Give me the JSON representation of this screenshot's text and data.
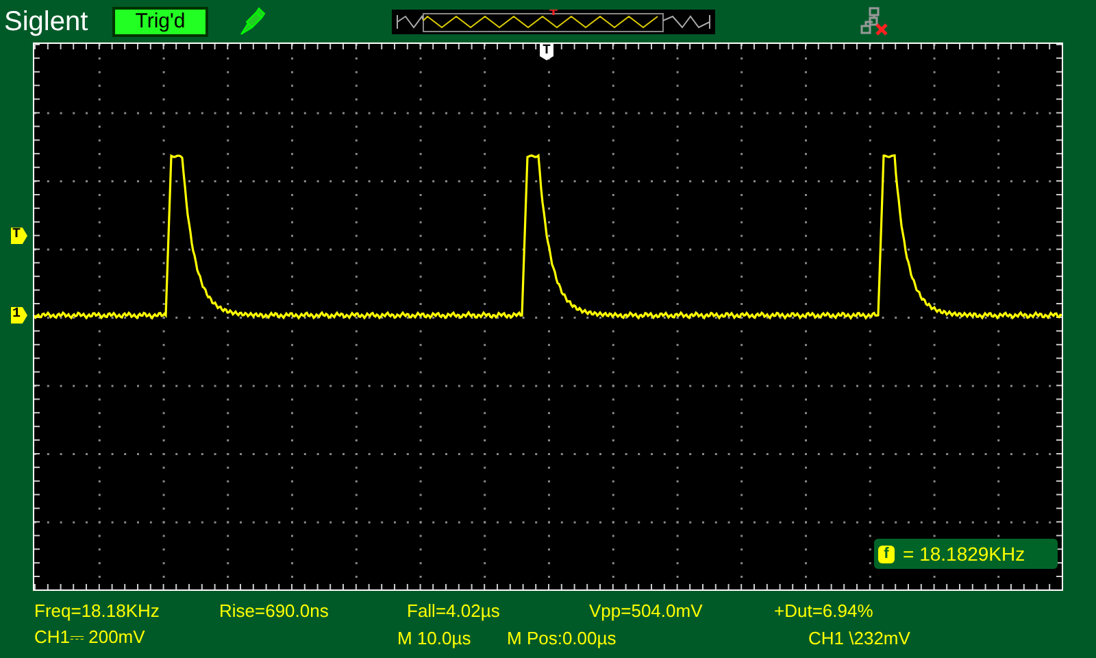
{
  "header": {
    "brand": "Siglent",
    "trigger_status": "Trig'd"
  },
  "screen": {
    "trigger_position_marker": "T",
    "trigger_level_marker": "T",
    "channel_marker": "1",
    "frequency_counter": {
      "label": "f",
      "value": "= 18.1829KHz"
    }
  },
  "measurements": [
    "Freq=18.18KHz",
    "Rise=690.0ns",
    "Fall=4.02µs",
    "Vpp=504.0mV",
    "+Dut=6.94%"
  ],
  "status_bar": {
    "channel_scale": "CH1⎓ 200mV",
    "timebase": "M 10.0µs",
    "time_position": "M Pos:0.00µs",
    "trigger_info": "CH1 \\232mV"
  }
}
